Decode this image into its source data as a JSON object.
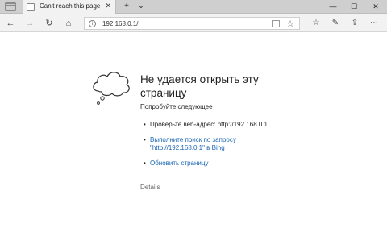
{
  "tab": {
    "title": "Can't reach this page",
    "close_glyph": "✕",
    "new_tab_glyph": "+",
    "dropdown_glyph": "⌄",
    "icon": "page-icon"
  },
  "window": {
    "minimize": "—",
    "maximize": "☐",
    "close": "✕"
  },
  "nav": {
    "back": "←",
    "forward": "→",
    "refresh": "↻",
    "home": "⌂",
    "url": "192.168.0.1/",
    "favorite": "☆"
  },
  "toolbar": {
    "favorites_hub": "☆",
    "notes": "✎",
    "share": "⇪",
    "more": "⋯"
  },
  "error": {
    "title": "Не удается открыть эту страницу",
    "subtitle": "Попробуйте следующее",
    "items": [
      {
        "text": "Проверьте веб-адрес: http://192.168.0.1"
      },
      {
        "line1": "Выполните поиск по запросу",
        "line2": "\"http://192.168.0.1\" в Bing"
      },
      {
        "text": "Обновить страницу"
      }
    ],
    "details": "Details"
  }
}
